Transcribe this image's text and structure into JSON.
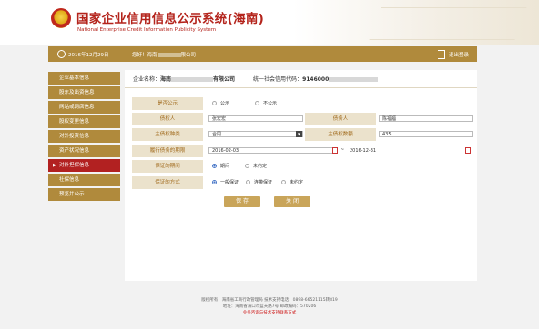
{
  "header": {
    "title": "国家企业信用信息公示系统(海南)",
    "subtitle": "National Enterprise Credit Information Publicity System"
  },
  "statusbar": {
    "date": "2016年12月29日",
    "welcome": "您好！海南",
    "welcome_suffix": "限公司",
    "logout": "退出登录"
  },
  "sidebar": {
    "items": [
      {
        "label": "企业基本信息"
      },
      {
        "label": "股东及出资信息"
      },
      {
        "label": "网站或网店信息"
      },
      {
        "label": "股权变更信息"
      },
      {
        "label": "对外投资信息"
      },
      {
        "label": "资产状况信息"
      },
      {
        "label": "对外担保信息",
        "active": true
      },
      {
        "label": "社保信息"
      },
      {
        "label": "预览并公示"
      }
    ]
  },
  "company": {
    "name_label": "企业名称：",
    "name_prefix": "海南",
    "name_suffix": "有限公司",
    "code_label": "统一社会信用代码：",
    "code_prefix": "9146000"
  },
  "form": {
    "publish_label": "是否公示",
    "publish_yes": "公示",
    "publish_no": "不公示",
    "creditor_label": "债权人",
    "creditor_value": "张宏宏",
    "debtor_label": "债务人",
    "debtor_value": "陈福福",
    "claim_type_label": "主债权种类",
    "claim_type_value": "合同",
    "claim_amount_label": "主债权数额",
    "claim_amount_value": "435",
    "period_label": "履行债务的期限",
    "period_start": "2016-02-03",
    "period_sep": "~",
    "period_end": "2016-12-31",
    "guarantee_period_label": "保证的期间",
    "guarantee_period_opt1": "期间",
    "guarantee_period_opt2": "未约定",
    "guarantee_mode_label": "保证的方式",
    "guarantee_mode_opt1": "一般保证",
    "guarantee_mode_opt2": "连带保证",
    "guarantee_mode_opt3": "未约定"
  },
  "buttons": {
    "save": "保 存",
    "close": "关 闭"
  },
  "footer": {
    "line1": "版权所有：海南省工商行政管理局  技术支持电话：0898-66521115转819",
    "line2": "地址：海南省海口市蓝天路7号  邮政编码：570206",
    "line3": "业务咨询与技术支持联系方式"
  }
}
